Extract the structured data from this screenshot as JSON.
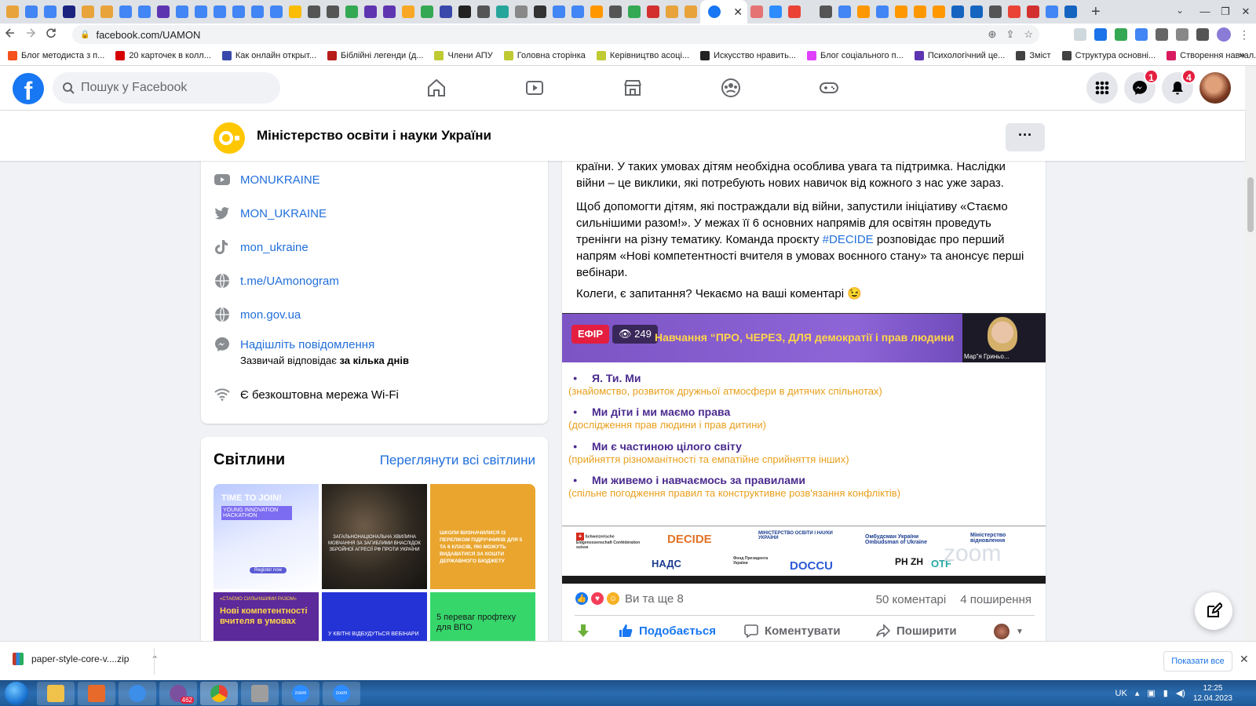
{
  "browser": {
    "url": "facebook.com/UAMON",
    "tab_close": "✕",
    "new_tab": "+",
    "window_controls": [
      "⌄",
      "—",
      "❐",
      "✕"
    ],
    "bookmarks": [
      {
        "label": "Блог методиста з п...",
        "color": "#f4511e"
      },
      {
        "label": "20 карточек в колл...",
        "color": "#d50000"
      },
      {
        "label": "Как онлайн открыт...",
        "color": "#3949ab"
      },
      {
        "label": "Біблійні легенди (д...",
        "color": "#b71c1c"
      },
      {
        "label": "Члени АПУ",
        "color": "#c0ca33"
      },
      {
        "label": "Головна сторінка",
        "color": "#c0ca33"
      },
      {
        "label": "Керівництво асоці...",
        "color": "#c0ca33"
      },
      {
        "label": "Искусство нравить...",
        "color": "#212121"
      },
      {
        "label": "Блог соціального п...",
        "color": "#e040fb"
      },
      {
        "label": "Психологічний це...",
        "color": "#5e35b1"
      },
      {
        "label": "Зміст",
        "color": "#424242"
      },
      {
        "label": "Структура основні...",
        "color": "#424242"
      },
      {
        "label": "Створення навчал...",
        "color": "#d81b60"
      }
    ],
    "bookmarks_more": "»"
  },
  "fb": {
    "logo_letter": "f",
    "search_placeholder": "Пошук у Facebook",
    "messenger_badge": "1",
    "notifications_badge": "4"
  },
  "page": {
    "name": "Міністерство освіти і науки України",
    "more": "···"
  },
  "intro": {
    "youtube": "MONUKRAINE",
    "twitter": "MON_UKRAINE",
    "tiktok": "mon_ukraine",
    "telegram": "t.me/UAmonogram",
    "website": "mon.gov.ua",
    "message_link": "Надішліть повідомлення",
    "reply_prefix": "Зазвичай відповідає ",
    "reply_bold": "за кілька днів",
    "wifi": "Є безкоштовна мережа Wi-Fi"
  },
  "photos": {
    "title": "Світлини",
    "see_all": "Переглянути всі світлини",
    "t1_head": "TIME TO JOIN!",
    "t1_sub": "YOUNG INNOVATION HACKATHON",
    "t1_btn": "Register now",
    "t2_text": "ЗАГАЛЬНОНАЦІОНАЛЬНА ХВИЛИНА МОВЧАННЯ ЗА ЗАГИБЛИМИ ВНАСЛІДОК ЗБРОЙНОЇ АГРЕСІЇ РФ ПРОТИ УКРАЇНИ",
    "t3_text": "ШКОЛИ ВИЗНАЧИЛИСЯ ІЗ ПЕРЕЛІКОМ ПІДРУЧНИКІВ ДЛЯ 5 ТА 6 КЛАСІВ, ЯКІ МОЖУТЬ ВИДАВАТИСЯ ЗА КОШТИ ДЕРЖАВНОГО БЮДЖЕТУ",
    "b1_tag": "«СТАЄМО СИЛЬНІШИМИ РАЗОМ»",
    "b1_text": "Нові компетентності вчителя в умовах",
    "b2_text": "У КВІТНІ ВІДБУДУТЬСЯ ВЕБІНАРИ",
    "b3_text": "5 переваг профтеху для ВПО"
  },
  "post": {
    "p1": "країни. У таких умовах дітям необхідна особлива увага та підтримка. Наслідки війни – це виклики, які потребують нових навичок від кожного з нас уже зараз.",
    "p2_start": "Щоб допомогти дітям, які постраждали від війни, запустили ініціативу «Стаємо сильнішими разом!». У межах її 6 основних напрямів для освітян проведуть тренінги на різну тематику. Команда проєкту ",
    "p2_hashtag": "#DECIDE",
    "p2_end": " розповідає про перший напрям «Нові компетентності вчителя в умовах воєнного стану» та анонсує перші вебінари.",
    "p3": "Колеги, є запитання? Чекаємо на ваші коментарі 😉"
  },
  "video": {
    "live_label": "ЕФІР",
    "viewers": "249",
    "title": "Навчання “ПРО, ЧЕРЕЗ, ДЛЯ демократії і прав людини",
    "presenter_name": "Мар\"я Гриньо...",
    "items": [
      {
        "title": "Я. Ти. Ми",
        "sub": "(знайомство, розвиток дружньої атмосфери в дитячих спільнотах)"
      },
      {
        "title": "Ми діти і ми маємо права",
        "sub": "(дослідження прав людини і прав дитини)"
      },
      {
        "title": "Ми є частиною цілого світу",
        "sub": "(прийняття різноманітності та емпатійне сприйняття інших)"
      },
      {
        "title": "Ми живемо і навчаємось за правилами",
        "sub": "(спільне погодження правил та конструктивне розв'язання конфліктів)"
      }
    ],
    "sponsors": {
      "swiss": "Schweizerische Eidgenossenschaft Confédération suisse",
      "decide": "DECIDE",
      "mon": "МІНІСТЕРСТВО ОСВІТИ І НАУКИ УКРАЇНИ",
      "ombudsman": "Омбудсман України Ombudsman of Ukraine",
      "minvid": "Міністерство відновлення",
      "nads": "НАДС",
      "fond": "Фонд Президента України",
      "docu": "DOCCU",
      "rnzh": "РН ZH",
      "ots": "OTF",
      "zoom": "zoom"
    }
  },
  "reactions": {
    "text": "Ви та ще 8",
    "comments": "50 коментарі",
    "shares": "4 поширення"
  },
  "actions": {
    "like": "Подобається",
    "comment": "Коментувати",
    "share": "Поширити"
  },
  "downloads": {
    "filename": "paper-style-core-v....zip",
    "show_all": "Показати все",
    "close": "✕"
  },
  "taskbar": {
    "lang": "UK",
    "time": "12:25",
    "date": "12.04.2023",
    "viber_badge": "462",
    "zoom1": "zoom",
    "zoom2": "zoom"
  }
}
